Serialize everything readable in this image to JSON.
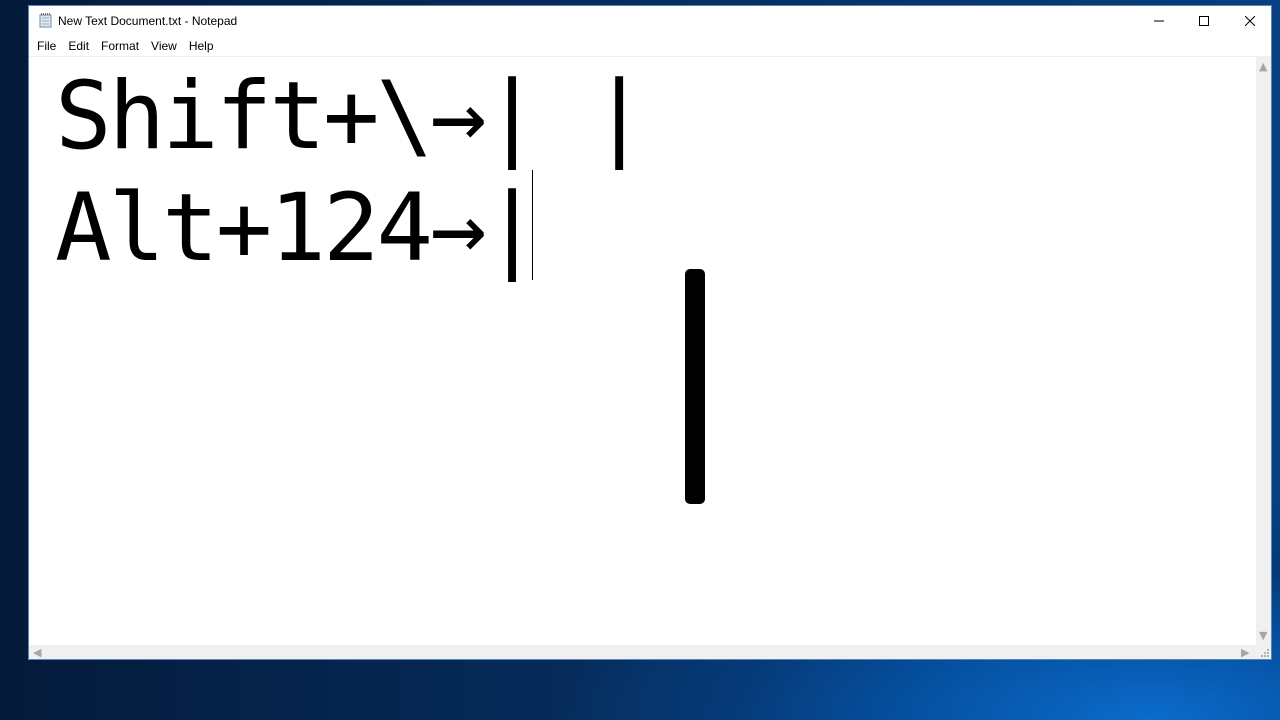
{
  "window": {
    "title": "New Text Document.txt - Notepad",
    "app_icon": "notepad-icon",
    "controls": {
      "minimize": "minimize-icon",
      "maximize": "maximize-icon",
      "close": "close-icon"
    }
  },
  "menubar": {
    "items": [
      {
        "label": "File"
      },
      {
        "label": "Edit"
      },
      {
        "label": "Format"
      },
      {
        "label": "View"
      },
      {
        "label": "Help"
      }
    ]
  },
  "editor": {
    "lines": [
      "Shift+\\→| |",
      "Alt+124→| "
    ],
    "caret": "text-caret",
    "mouse_cursor": "ibeam-cursor-icon",
    "overlay": "large-pipe-symbol"
  },
  "scrollbars": {
    "up": "▲",
    "down": "▼",
    "left": "◀",
    "right": "▶"
  }
}
